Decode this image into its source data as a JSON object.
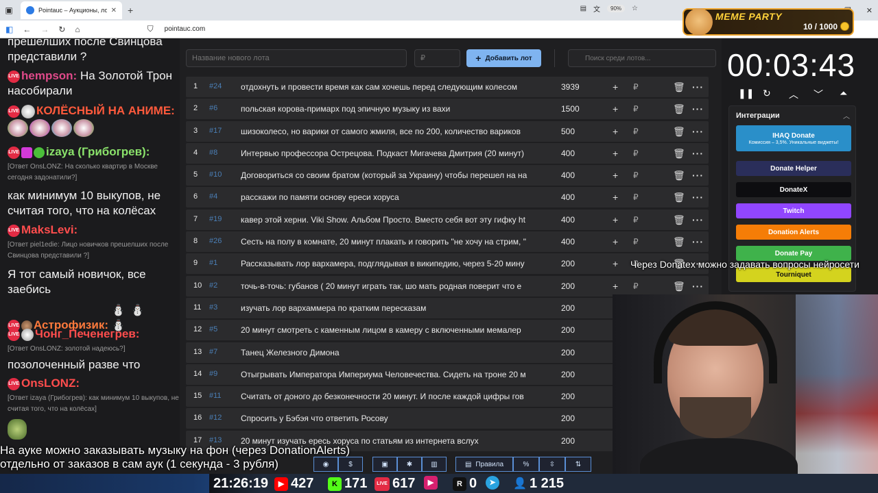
{
  "browser": {
    "tab_title": "Pointauc – Аукционы, лотереи",
    "url": "pointauc.com",
    "zoom": "90%"
  },
  "meme_party": {
    "title": "MEME PARTY",
    "count": "10 / 1000"
  },
  "chat": {
    "lines": [
      {
        "text": "прешелших после Свинцова представили ?"
      },
      {
        "nick": "hempson:",
        "text": "На Золотой Трон насобирали",
        "nick_color": "#e04a8a"
      },
      {
        "nick": "КОЛЁСНЫЙ НА АНИМЕ:",
        "nick_color": "#ff5a3c"
      },
      {
        "nick": "izaya (Грибогрев):",
        "nick_color": "#8be36b"
      },
      {
        "reply": "[Ответ OnsLONZ: На сколько квартир в Москве сегодня задонатили?]"
      },
      {
        "text": "как минимум 10 выкупов, не считая того, что на колёсах"
      },
      {
        "nick": "MaksLevi:",
        "nick_color": "#ff4d4d"
      },
      {
        "reply": "[Ответ piel1edie: Лицо новичков прешелших после Свинцова представили ?]"
      },
      {
        "text": "Я тот самый новичок, все заебись"
      },
      {
        "nick": "Астрофизик:",
        "nick_color": "#ff7a3c"
      },
      {
        "nick": "Чонг_Печенегрев:",
        "nick_color": "#ff4d4d"
      },
      {
        "reply": "[Ответ OnsLONZ: золотой надеюсь?]"
      },
      {
        "text": "позолоченный разве что"
      },
      {
        "nick": "OnsLONZ:",
        "nick_color": "#ff4d4d"
      },
      {
        "reply": "[Ответ izaya (Грибогрев): как минимум 10 выкупов, не считая того, что на колёсах]"
      }
    ],
    "live_badge": "LIVE"
  },
  "main": {
    "lot_placeholder": "Название нового лота",
    "price_placeholder": "₽",
    "add_button": "Добавить лот",
    "search_placeholder": "Поиск среди лотов...",
    "lots": [
      {
        "n": "1",
        "id": "#24",
        "name": "отдохнуть и провести время как сам хочешь перед следующим колесом",
        "amount": "3939"
      },
      {
        "n": "2",
        "id": "#6",
        "name": "польская корова-примарх под эпичную музыку из вахи",
        "amount": "1500"
      },
      {
        "n": "3",
        "id": "#17",
        "name": "шизоколесо, но варики от самого жмиля, все по 200, количество вариков",
        "amount": "500"
      },
      {
        "n": "4",
        "id": "#8",
        "name": "Интервью профессора Острецова. Подкаст Мигачева Дмитрия (20 минут)",
        "amount": "400"
      },
      {
        "n": "5",
        "id": "#10",
        "name": "Договориться со своим братом (который за Украину) чтобы перешел на на",
        "amount": "400"
      },
      {
        "n": "6",
        "id": "#4",
        "name": "расскажи по памяти основу ереси хоруса",
        "amount": "400"
      },
      {
        "n": "7",
        "id": "#19",
        "name": "кавер этой херни. Viki Show. Альбом Просто. Вместо себя вот эту гифку ht",
        "amount": "400"
      },
      {
        "n": "8",
        "id": "#26",
        "name": "Сесть на полу в комнате, 20 минут плакать и говорить \"не хочу на стрим, \"",
        "amount": "400"
      },
      {
        "n": "9",
        "id": "#1",
        "name": "Рассказывать лор вархамера, подглядывая в википедию, через 5-20 мину",
        "amount": "200"
      },
      {
        "n": "10",
        "id": "#2",
        "name": "точь-в-точь: губанов ( 20 минут играть так, шо мать родная поверит что е",
        "amount": "200"
      },
      {
        "n": "11",
        "id": "#3",
        "name": "изучать лор вархаммера по кратким пересказам",
        "amount": "200"
      },
      {
        "n": "12",
        "id": "#5",
        "name": "20 минут смотреть с каменным лицом в камеру с включенными мемалер",
        "amount": "200"
      },
      {
        "n": "13",
        "id": "#7",
        "name": "Танец Железного Димона",
        "amount": "200"
      },
      {
        "n": "14",
        "id": "#9",
        "name": "Отыгрывать Императора Империума Человечества. Сидеть на троне 20 м",
        "amount": "200"
      },
      {
        "n": "15",
        "id": "#11",
        "name": "Считать от доного до безконечности 20 минут. И после каждой цифры гов",
        "amount": "200"
      },
      {
        "n": "16",
        "id": "#12",
        "name": "Спросить у Бэбэя что ответить Росову",
        "amount": "200"
      },
      {
        "n": "17",
        "id": "#13",
        "name": "20 минут изучать ересь хоруса по статьям из интернета вслух",
        "amount": "200"
      }
    ]
  },
  "right": {
    "timer": "00:03:43",
    "integrations_title": "Интеграции",
    "integrations": [
      {
        "label": "IHAQ Donate",
        "sub": "Комиссия – 3,5%. Уникальные виджеты!",
        "color": "#2a8fc9"
      },
      {
        "label": "Donate Helper",
        "color": "#2a2e5a"
      },
      {
        "label": "DonateX",
        "color": "#0d0d10"
      },
      {
        "label": "Twitch",
        "color": "#9146ff"
      },
      {
        "label": "Donation Alerts",
        "color": "#f57d07"
      },
      {
        "label": "Donate Pay",
        "color": "#3fb24b"
      },
      {
        "label": "Tourniquet",
        "color": "#d4d31e"
      }
    ]
  },
  "captions": {
    "music_line1": "На ауке можно заказывать музыку на фон (через DonationAlerts)",
    "music_line2": "отдельно от заказов в сам аук (1 секунда - 3 рубля)",
    "donatex": "Через Donatex можно задавать вопросы нейросети"
  },
  "toolbar": {
    "rules": "Правила"
  },
  "status": {
    "time": "21:26:19",
    "youtube": "427",
    "kick": "171",
    "vk": "617",
    "rutube": "0",
    "viewers": "1 215"
  }
}
